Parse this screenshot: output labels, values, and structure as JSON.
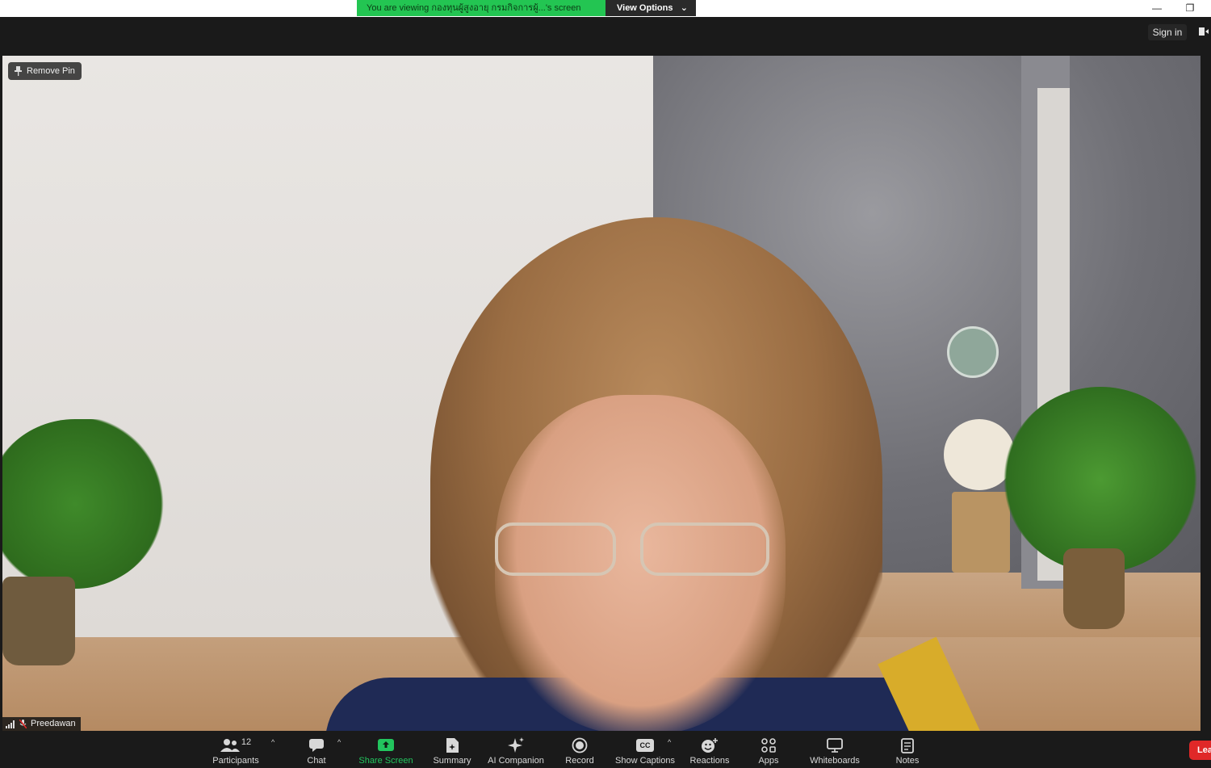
{
  "banner": {
    "viewing_text": "You are viewing กองทุนผู้สูงอายุ กรมกิจการผู้...'s screen",
    "view_options": "View Options"
  },
  "window_controls": {
    "minimize": "—",
    "restore": "❐"
  },
  "topbar": {
    "sign_in": "Sign in"
  },
  "video": {
    "remove_pin": "Remove Pin",
    "participant_name": "Preedawan"
  },
  "toolbar": {
    "participants_label": "Participants",
    "participants_count": "12",
    "chat_label": "Chat",
    "share_label": "Share Screen",
    "summary_label": "Summary",
    "ai_label": "AI Companion",
    "record_label": "Record",
    "captions_label": "Show Captions",
    "captions_icon_text": "CC",
    "reactions_label": "Reactions",
    "apps_label": "Apps",
    "whiteboards_label": "Whiteboards",
    "notes_label": "Notes",
    "leave_label": "Leave"
  },
  "colors": {
    "banner_green": "#23c552",
    "share_green": "#22c55e",
    "leave_red": "#e02828",
    "toolbar_bg": "#1a1a1a"
  }
}
